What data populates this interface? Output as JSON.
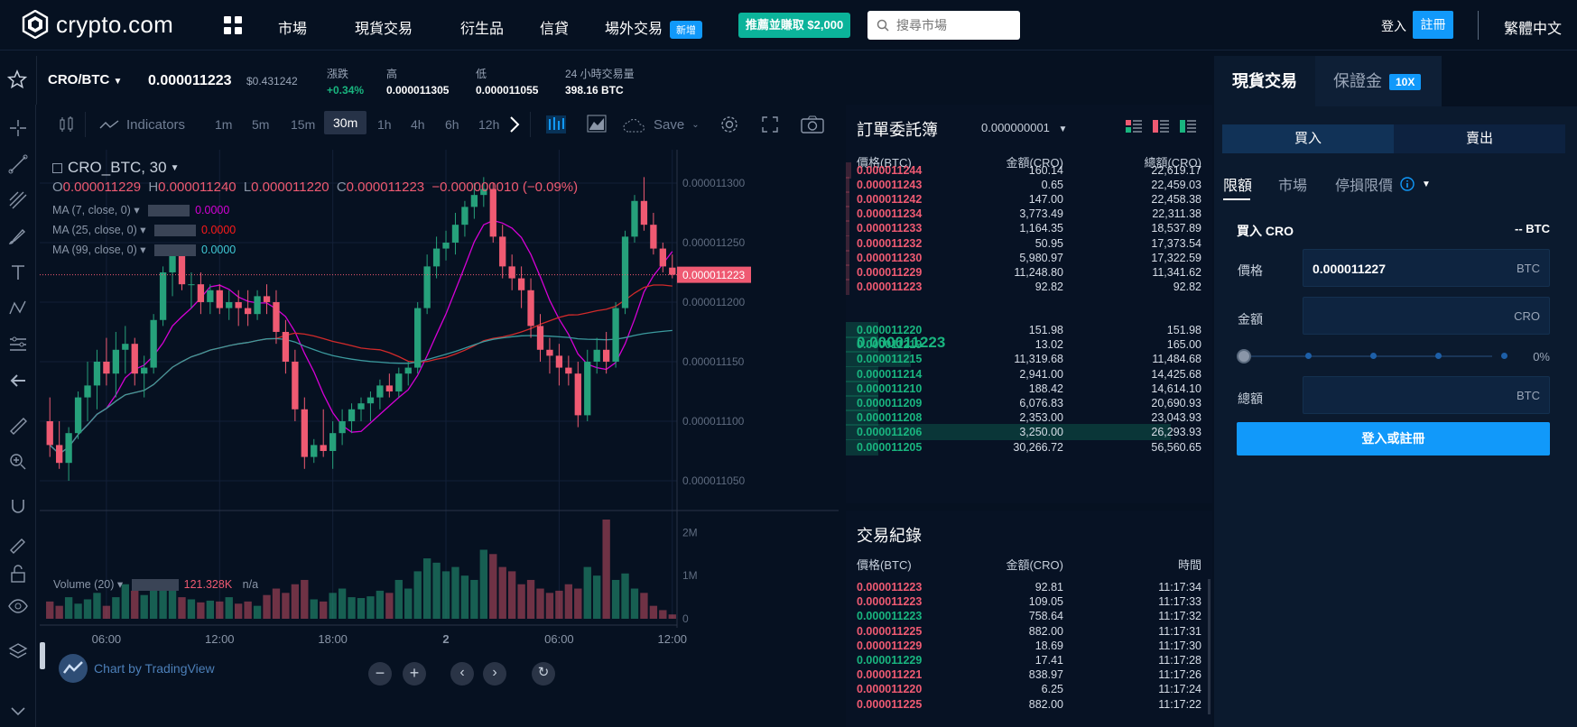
{
  "nav": {
    "brand": "crypto.com",
    "items": [
      "市場",
      "現貨交易",
      "衍生品",
      "信貸",
      "場外交易"
    ],
    "new_badge": "新增",
    "promo": "推薦並賺取 $2,000",
    "search_placeholder": "搜尋市場",
    "login": "登入",
    "register": "註冊",
    "language": "繁體中文"
  },
  "pair": {
    "symbol": "CRO/BTC",
    "last_price": "0.000011223",
    "usd_price": "$0.431242",
    "change_label": "漲跌",
    "change_value": "+0.34%",
    "high_label": "高",
    "high_value": "0.000011305",
    "low_label": "低",
    "low_value": "0.000011055",
    "volume_label": "24 小時交易量",
    "volume_value": "398.16 BTC"
  },
  "toolbar": {
    "indicators": "Indicators",
    "intervals": [
      "1m",
      "5m",
      "15m",
      "30m",
      "1h",
      "4h",
      "6h",
      "12h"
    ],
    "active_interval": "30m",
    "save": "Save"
  },
  "chart_data": {
    "type": "candlestick",
    "symbol_label": "CRO_BTC, 30",
    "ohlc_labels": {
      "o": "O",
      "h": "H",
      "l": "L",
      "c": "C"
    },
    "ohlc_values": {
      "o": "0.000011229",
      "h": "0.000011240",
      "l": "0.000011220",
      "c": "0.000011223",
      "change": "−0.000000010 (−0.09%)"
    },
    "indicators": [
      {
        "label": "MA (7, close, 0)",
        "value": "0.0000",
        "color": "#d500d5"
      },
      {
        "label": "MA (25, close, 0)",
        "value": "0.0000",
        "color": "#ff1a1a"
      },
      {
        "label": "MA (99, close, 0)",
        "value": "0.0000",
        "color": "#3ec9d6"
      }
    ],
    "y_ticks": [
      "0.000011300",
      "0.000011250",
      "0.000011200",
      "0.000011150",
      "0.000011100",
      "0.000011050"
    ],
    "y_tick_values": [
      11300,
      11250,
      11200,
      11150,
      11100,
      11050
    ],
    "ylim": [
      11025,
      11328
    ],
    "current_price_label": "0.000011223",
    "current_price": 11223,
    "x_ticks": [
      "06:00",
      "12:00",
      "18:00",
      "2",
      "06:00",
      "12:00"
    ],
    "x_tick_index": [
      6,
      18,
      30,
      42,
      54,
      66
    ],
    "candles": [
      [
        11100,
        11120,
        11070,
        11080
      ],
      [
        11080,
        11100,
        11060,
        11065
      ],
      [
        11065,
        11095,
        11050,
        11090
      ],
      [
        11090,
        11125,
        11085,
        11120
      ],
      [
        11120,
        11150,
        11100,
        11130
      ],
      [
        11130,
        11160,
        11110,
        11150
      ],
      [
        11150,
        11170,
        11130,
        11140
      ],
      [
        11140,
        11175,
        11120,
        11160
      ],
      [
        11160,
        11180,
        11140,
        11165
      ],
      [
        11165,
        11170,
        11130,
        11140
      ],
      [
        11140,
        11155,
        11120,
        11145
      ],
      [
        11145,
        11190,
        11140,
        11185
      ],
      [
        11185,
        11230,
        11180,
        11225
      ],
      [
        11225,
        11245,
        11205,
        11240
      ],
      [
        11240,
        11245,
        11210,
        11215
      ],
      [
        11215,
        11225,
        11195,
        11215
      ],
      [
        11215,
        11225,
        11190,
        11200
      ],
      [
        11200,
        11215,
        11190,
        11210
      ],
      [
        11210,
        11215,
        11190,
        11195
      ],
      [
        11195,
        11210,
        11185,
        11200
      ],
      [
        11200,
        11210,
        11180,
        11195
      ],
      [
        11195,
        11210,
        11180,
        11190
      ],
      [
        11190,
        11210,
        11185,
        11205
      ],
      [
        11205,
        11215,
        11190,
        11200
      ],
      [
        11200,
        11210,
        11165,
        11175
      ],
      [
        11175,
        11185,
        11140,
        11150
      ],
      [
        11150,
        11160,
        11100,
        11110
      ],
      [
        11110,
        11120,
        11060,
        11070
      ],
      [
        11070,
        11085,
        11065,
        11080
      ],
      [
        11080,
        11110,
        11070,
        11075
      ],
      [
        11075,
        11100,
        11060,
        11090
      ],
      [
        11090,
        11110,
        11080,
        11100
      ],
      [
        11100,
        11115,
        11090,
        11110
      ],
      [
        11110,
        11120,
        11100,
        11115
      ],
      [
        11115,
        11125,
        11100,
        11120
      ],
      [
        11120,
        11135,
        11110,
        11130
      ],
      [
        11130,
        11140,
        11120,
        11125
      ],
      [
        11125,
        11145,
        11120,
        11140
      ],
      [
        11140,
        11150,
        11130,
        11145
      ],
      [
        11145,
        11200,
        11140,
        11195
      ],
      [
        11195,
        11240,
        11190,
        11230
      ],
      [
        11230,
        11255,
        11220,
        11245
      ],
      [
        11245,
        11260,
        11235,
        11250
      ],
      [
        11250,
        11275,
        11240,
        11265
      ],
      [
        11265,
        11285,
        11255,
        11280
      ],
      [
        11280,
        11300,
        11270,
        11290
      ],
      [
        11290,
        11305,
        11280,
        11295
      ],
      [
        11295,
        11300,
        11250,
        11255
      ],
      [
        11255,
        11265,
        11220,
        11230
      ],
      [
        11230,
        11240,
        11210,
        11220
      ],
      [
        11220,
        11230,
        11195,
        11210
      ],
      [
        11210,
        11220,
        11170,
        11180
      ],
      [
        11180,
        11190,
        11150,
        11160
      ],
      [
        11160,
        11170,
        11140,
        11155
      ],
      [
        11155,
        11165,
        11130,
        11145
      ],
      [
        11145,
        11155,
        11130,
        11140
      ],
      [
        11140,
        11150,
        11095,
        11105
      ],
      [
        11105,
        11160,
        11100,
        11150
      ],
      [
        11150,
        11170,
        11140,
        11160
      ],
      [
        11160,
        11175,
        11140,
        11150
      ],
      [
        11150,
        11200,
        11145,
        11195
      ],
      [
        11195,
        11260,
        11190,
        11255
      ],
      [
        11255,
        11290,
        11250,
        11285
      ],
      [
        11285,
        11305,
        11260,
        11265
      ],
      [
        11265,
        11275,
        11240,
        11245
      ],
      [
        11245,
        11250,
        11225,
        11230
      ],
      [
        11229,
        11240,
        11220,
        11223
      ]
    ],
    "volume_label": "Volume (20)",
    "volume_value": "121.328K",
    "volume_na": "n/a",
    "volume_ticks": [
      "2M",
      "1M",
      "0"
    ],
    "volume_tick_values": [
      2000000,
      1000000,
      0
    ],
    "volume_max": 2300000,
    "volumes": [
      400,
      300,
      500,
      350,
      450,
      600,
      300,
      500,
      800,
      650,
      550,
      700,
      850,
      900,
      500,
      450,
      380,
      420,
      400,
      500,
      350,
      400,
      300,
      550,
      700,
      600,
      800,
      900,
      450,
      400,
      600,
      700,
      500,
      480,
      520,
      650,
      600,
      900,
      700,
      1100,
      1400,
      1300,
      1100,
      1200,
      1000,
      900,
      1600,
      1500,
      1200,
      1100,
      800,
      900,
      700,
      600,
      650,
      800,
      700,
      1200,
      1000,
      2300,
      900,
      1050,
      700,
      600,
      300,
      200,
      100
    ],
    "volume_scale": 1000,
    "watermark": "Chart by TradingView"
  },
  "orderbook": {
    "title": "訂單委託簿",
    "precision": "0.000000001",
    "headers": [
      "價格(BTC)",
      "金額(CRO)",
      "總額(CRO)"
    ],
    "asks": [
      {
        "price": "0.000011244",
        "amount": "160.14",
        "total": "22,619.17",
        "depth": 0.14
      },
      {
        "price": "0.000011243",
        "amount": "0.65",
        "total": "22,459.03",
        "depth": 0.1
      },
      {
        "price": "0.000011242",
        "amount": "147.00",
        "total": "22,458.38",
        "depth": 0.1
      },
      {
        "price": "0.000011234",
        "amount": "3,773.49",
        "total": "22,311.38",
        "depth": 0.1
      },
      {
        "price": "0.000011233",
        "amount": "1,164.35",
        "total": "18,537.89",
        "depth": 0.1
      },
      {
        "price": "0.000011232",
        "amount": "50.95",
        "total": "17,373.54",
        "depth": 0.1
      },
      {
        "price": "0.000011230",
        "amount": "5,980.97",
        "total": "17,322.59",
        "depth": 0.1
      },
      {
        "price": "0.000011229",
        "amount": "11,248.80",
        "total": "11,341.62",
        "depth": 0.1
      },
      {
        "price": "0.000011223",
        "amount": "92.82",
        "total": "92.82",
        "depth": 0.1
      }
    ],
    "mid_price": "0.000011223",
    "bids": [
      {
        "price": "0.000011220",
        "amount": "151.98",
        "total": "151.98",
        "depth": 0.1
      },
      {
        "price": "0.000011219",
        "amount": "13.02",
        "total": "165.00",
        "depth": 0.1
      },
      {
        "price": "0.000011215",
        "amount": "11,319.68",
        "total": "11,484.68",
        "depth": 0.2
      },
      {
        "price": "0.000011214",
        "amount": "2,941.00",
        "total": "14,425.68",
        "depth": 0.1
      },
      {
        "price": "0.000011210",
        "amount": "188.42",
        "total": "14,614.10",
        "depth": 0.1
      },
      {
        "price": "0.000011209",
        "amount": "6,076.83",
        "total": "20,690.93",
        "depth": 0.1
      },
      {
        "price": "0.000011208",
        "amount": "2,353.00",
        "total": "23,043.93",
        "depth": 0.1
      },
      {
        "price": "0.000011206",
        "amount": "3,250.00",
        "total": "26,293.93",
        "depth": 1.0
      },
      {
        "price": "0.000011205",
        "amount": "30,266.72",
        "total": "56,560.65",
        "depth": 0.1
      }
    ]
  },
  "trades": {
    "title": "交易紀錄",
    "headers": [
      "價格(BTC)",
      "金額(CRO)",
      "時間"
    ],
    "rows": [
      {
        "price": "0.000011223",
        "amount": "92.81",
        "time": "11:17:34",
        "side": "sell"
      },
      {
        "price": "0.000011223",
        "amount": "109.05",
        "time": "11:17:33",
        "side": "sell"
      },
      {
        "price": "0.000011223",
        "amount": "758.64",
        "time": "11:17:32",
        "side": "buy"
      },
      {
        "price": "0.000011225",
        "amount": "882.00",
        "time": "11:17:31",
        "side": "sell"
      },
      {
        "price": "0.000011229",
        "amount": "18.69",
        "time": "11:17:30",
        "side": "sell"
      },
      {
        "price": "0.000011229",
        "amount": "17.41",
        "time": "11:17:28",
        "side": "buy"
      },
      {
        "price": "0.000011221",
        "amount": "838.97",
        "time": "11:17:26",
        "side": "sell"
      },
      {
        "price": "0.000011220",
        "amount": "6.25",
        "time": "11:17:24",
        "side": "sell"
      },
      {
        "price": "0.000011225",
        "amount": "882.00",
        "time": "11:17:22",
        "side": "sell"
      }
    ]
  },
  "panel": {
    "tab_spot": "現貨交易",
    "tab_margin": "保證金",
    "margin_badge": "10X",
    "buy": "買入",
    "sell": "賣出",
    "order_types": [
      "限額",
      "市場",
      "停損限價"
    ],
    "form_title": "買入 CRO",
    "balance": "-- BTC",
    "price_label": "價格",
    "price_value": "0.000011227",
    "price_unit": "BTC",
    "amount_label": "金額",
    "amount_unit": "CRO",
    "slider_pct": "0%",
    "total_label": "總額",
    "total_unit": "BTC",
    "login_button": "登入或註冊"
  },
  "colors": {
    "up": "#26a17b",
    "down": "#ef5a72",
    "accent": "#1199fa"
  }
}
